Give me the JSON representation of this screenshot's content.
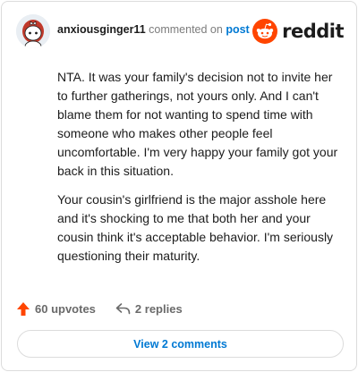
{
  "header": {
    "username": "anxiousginger11",
    "commented_text": "commented on",
    "post_link": "post"
  },
  "brand": {
    "wordmark": "reddit",
    "color": "#ff4500"
  },
  "comment": {
    "paragraphs": [
      "NTA. It was your family's decision not to invite her to further gatherings, not yours only. And I can't blame them for not wanting to spend time with someone who makes other people feel uncomfortable. I'm very happy your family got your back in this situation.",
      "Your cousin's girlfriend is the major asshole here and it's shocking to me that both her and your cousin think it's acceptable behavior. I'm seriously questioning their maturity."
    ]
  },
  "actions": {
    "upvotes": "60 upvotes",
    "replies": "2 replies",
    "upvote_color": "#ff4500"
  },
  "view_comments": "View 2 comments",
  "icons": {
    "avatar": "snoo-avatar",
    "brand": "reddit-logo-icon",
    "upvote": "upvote-arrow-icon",
    "reply": "reply-arrow-icon"
  }
}
